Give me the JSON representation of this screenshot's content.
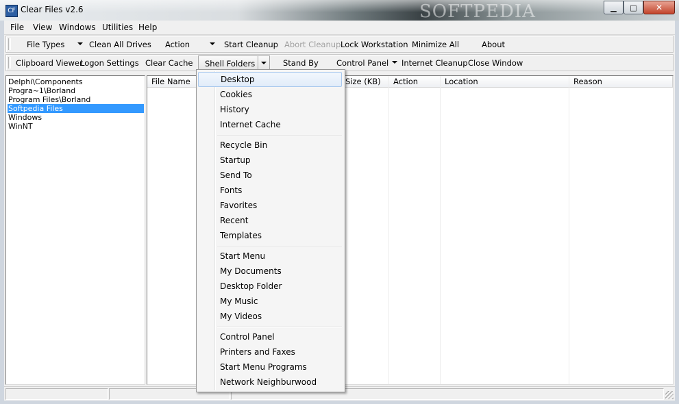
{
  "window": {
    "title": "Clear Files v2.6",
    "icon_label": "CF",
    "watermark": "SOFTPEDIA",
    "controls": {
      "minimize": "▁",
      "maximize": "□",
      "close": "✕"
    }
  },
  "menubar": [
    "File",
    "View",
    "Windows",
    "Utilities",
    "Help"
  ],
  "toolbar1": {
    "file_types": "File Types",
    "clean_all_drives": "Clean All Drives",
    "action": "Action",
    "start_cleanup": "Start Cleanup",
    "abort_cleanup": "Abort Cleanup",
    "lock_workstation": "Lock Workstation",
    "minimize_all": "Minimize All",
    "about": "About"
  },
  "toolbar2": {
    "clipboard_viewer": "Clipboard Viewer",
    "logon_settings": "Logon Settings",
    "clear_cache": "Clear Cache",
    "shell_folders": "Shell Folders",
    "stand_by": "Stand By",
    "control_panel": "Control Panel",
    "internet_cleanup": "Internet Cleanup",
    "close_window": "Close Window"
  },
  "folders": [
    "Delphi\\Components",
    "Progra~1\\Borland",
    "Program Files\\Borland",
    "Softpedia Files",
    "Windows",
    "WinNT"
  ],
  "selected_folder_index": 3,
  "grid": {
    "columns": [
      "File Name",
      "Size (KB)",
      "Action",
      "Location",
      "Reason"
    ]
  },
  "shell_menu": {
    "groups": [
      [
        "Desktop",
        "Cookies",
        "History",
        "Internet Cache"
      ],
      [
        "Recycle Bin",
        "Startup",
        "Send To",
        "Fonts",
        "Favorites",
        "Recent",
        "Templates"
      ],
      [
        "Start Menu",
        "My Documents",
        "Desktop Folder",
        "My Music",
        "My Videos"
      ],
      [
        "Control Panel",
        "Printers and Faxes",
        "Start Menu Programs",
        "Network Neighburwood"
      ]
    ],
    "highlighted": "Desktop"
  },
  "colors": {
    "selection": "#3399ff",
    "menu_highlight": "#e1ecf9"
  }
}
